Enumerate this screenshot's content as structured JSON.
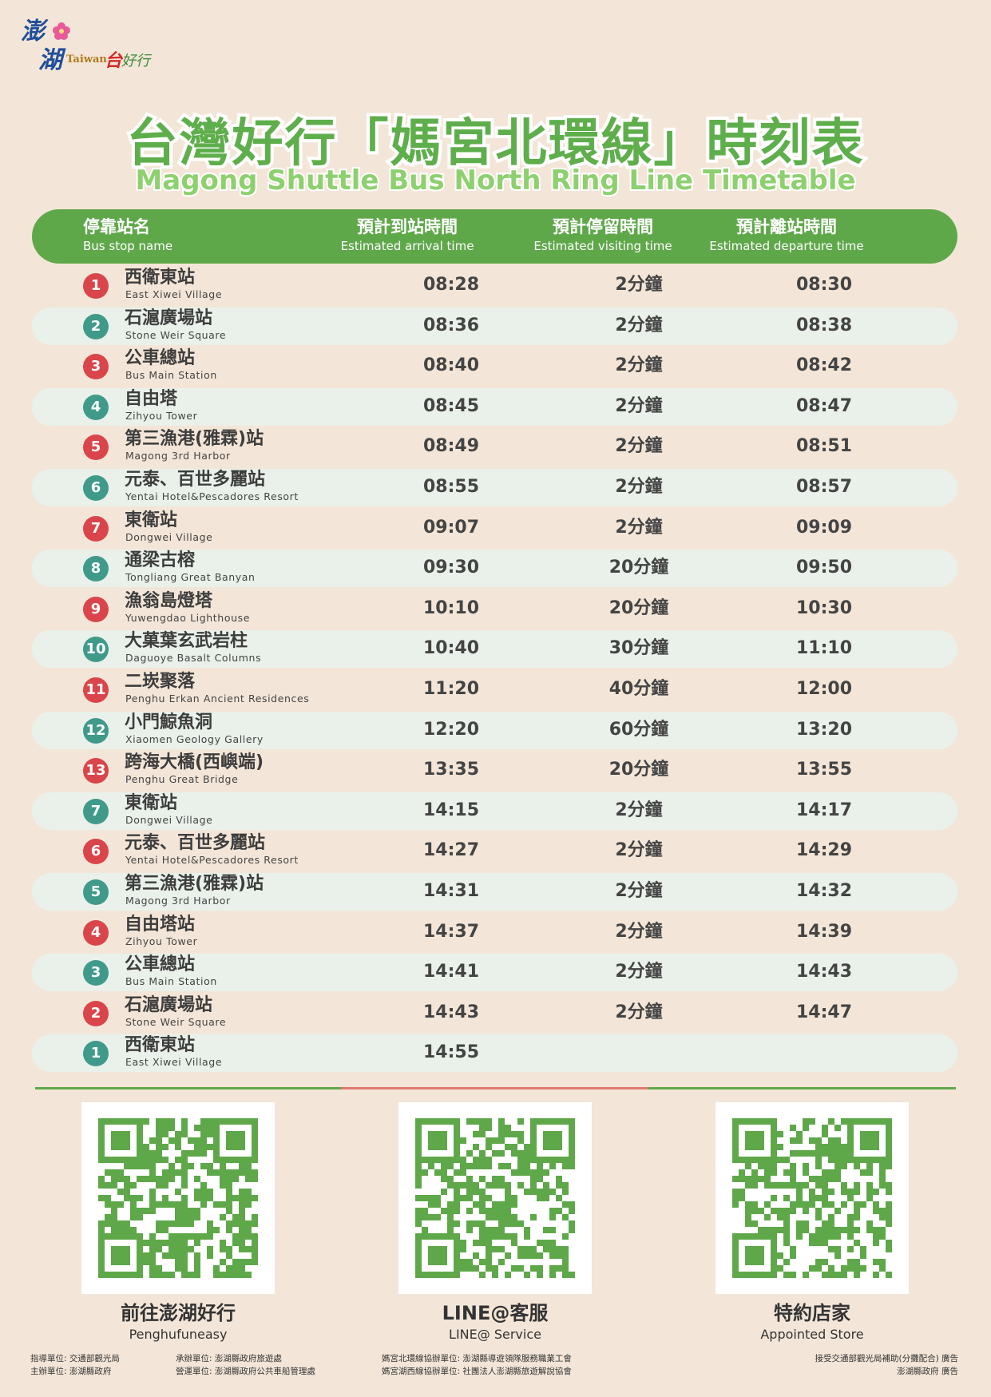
{
  "logo": {
    "p1": "澎",
    "p2": "湖",
    "taiwan": "Taiwan",
    "hx": "台",
    "hx2": "好行"
  },
  "title": {
    "zh": "台灣好行「媽宮北環線」時刻表",
    "en": "Magong Shuttle Bus North Ring Line Timetable"
  },
  "colors": {
    "green": "#5fa84a",
    "red": "#d9454a",
    "teal": "#3f9a8a",
    "band": "#e9f1ea",
    "background": "#f3e6d8"
  },
  "header": {
    "stop": {
      "zh": "停靠站名",
      "en": "Bus stop name"
    },
    "arrival": {
      "zh": "預計到站時間",
      "en": "Estimated arrival time"
    },
    "visit": {
      "zh": "預計停留時間",
      "en": "Estimated visiting time"
    },
    "depart": {
      "zh": "預計離站時間",
      "en": "Estimated departure time"
    }
  },
  "rows": [
    {
      "num": "1",
      "color": "red",
      "zh": "西衛東站",
      "en": "East Xiwei Village",
      "arrival": "08:28",
      "visit": "2分鐘",
      "depart": "08:30"
    },
    {
      "num": "2",
      "color": "teal",
      "zh": "石滬廣場站",
      "en": "Stone Weir Square",
      "arrival": "08:36",
      "visit": "2分鐘",
      "depart": "08:38"
    },
    {
      "num": "3",
      "color": "red",
      "zh": "公車總站",
      "en": "Bus Main Station",
      "arrival": "08:40",
      "visit": "2分鐘",
      "depart": "08:42"
    },
    {
      "num": "4",
      "color": "teal",
      "zh": "自由塔",
      "en": "Zihyou Tower",
      "arrival": "08:45",
      "visit": "2分鐘",
      "depart": "08:47"
    },
    {
      "num": "5",
      "color": "red",
      "zh": "第三漁港(雅霖)站",
      "en": "Magong 3rd Harbor",
      "arrival": "08:49",
      "visit": "2分鐘",
      "depart": "08:51"
    },
    {
      "num": "6",
      "color": "teal",
      "zh": "元泰、百世多麗站",
      "en": "Yentai Hotel&Pescadores Resort",
      "arrival": "08:55",
      "visit": "2分鐘",
      "depart": "08:57"
    },
    {
      "num": "7",
      "color": "red",
      "zh": "東衛站",
      "en": "Dongwei Village",
      "arrival": "09:07",
      "visit": "2分鐘",
      "depart": "09:09"
    },
    {
      "num": "8",
      "color": "teal",
      "zh": "通梁古榕",
      "en": "Tongliang Great Banyan",
      "arrival": "09:30",
      "visit": "20分鐘",
      "depart": "09:50"
    },
    {
      "num": "9",
      "color": "red",
      "zh": "漁翁島燈塔",
      "en": "Yuwengdao  Lighthouse",
      "arrival": "10:10",
      "visit": "20分鐘",
      "depart": "10:30"
    },
    {
      "num": "10",
      "color": "teal",
      "zh": "大菓葉玄武岩柱",
      "en": "Daguoye Basalt Columns",
      "arrival": "10:40",
      "visit": "30分鐘",
      "depart": "11:10"
    },
    {
      "num": "11",
      "color": "red",
      "zh": "二崁聚落",
      "en": "Penghu Erkan Ancient Residences",
      "arrival": "11:20",
      "visit": "40分鐘",
      "depart": "12:00"
    },
    {
      "num": "12",
      "color": "teal",
      "zh": "小門鯨魚洞",
      "en": "Xiaomen Geology Gallery",
      "arrival": "12:20",
      "visit": "60分鐘",
      "depart": "13:20"
    },
    {
      "num": "13",
      "color": "red",
      "zh": "跨海大橋(西嶼端)",
      "en": "Penghu Great Bridge",
      "arrival": "13:35",
      "visit": "20分鐘",
      "depart": "13:55"
    },
    {
      "num": "7",
      "color": "teal",
      "zh": "東衛站",
      "en": "Dongwei Village",
      "arrival": "14:15",
      "visit": "2分鐘",
      "depart": "14:17"
    },
    {
      "num": "6",
      "color": "red",
      "zh": "元泰、百世多麗站",
      "en": "Yentai Hotel&Pescadores Resort",
      "arrival": "14:27",
      "visit": "2分鐘",
      "depart": "14:29"
    },
    {
      "num": "5",
      "color": "teal",
      "zh": "第三漁港(雅霖)站",
      "en": "Magong 3rd Harbor",
      "arrival": "14:31",
      "visit": "2分鐘",
      "depart": "14:32"
    },
    {
      "num": "4",
      "color": "red",
      "zh": "自由塔站",
      "en": "Zihyou Tower",
      "arrival": "14:37",
      "visit": "2分鐘",
      "depart": "14:39"
    },
    {
      "num": "3",
      "color": "teal",
      "zh": "公車總站",
      "en": "Bus Main Station",
      "arrival": "14:41",
      "visit": "2分鐘",
      "depart": "14:43"
    },
    {
      "num": "2",
      "color": "red",
      "zh": "石滬廣場站",
      "en": "Stone Weir Square",
      "arrival": "14:43",
      "visit": "2分鐘",
      "depart": "14:47"
    },
    {
      "num": "1",
      "color": "teal",
      "zh": "西衛東站",
      "en": "East Xiwei Village",
      "arrival": "14:55",
      "visit": "",
      "depart": ""
    }
  ],
  "qr": [
    {
      "zh": "前往澎湖好行",
      "en": "Penghufuneasy",
      "icon": "qr-code-icon"
    },
    {
      "zh": "LINE@客服",
      "en": "LINE@ Service",
      "icon": "qr-code-icon"
    },
    {
      "zh": "特約店家",
      "en": "Appointed Store",
      "icon": "qr-code-icon"
    }
  ],
  "footer": {
    "col1a": "指導單位: 交通部觀光局",
    "col1b": "主辦單位: 澎湖縣政府",
    "col2a": "承辦單位: 澎湖縣政府旅遊處",
    "col2b": "營運單位: 澎湖縣政府公共車船管理處",
    "col3a": "媽宮北環線協辦單位: 澎湖縣導遊領隊服務職業工會",
    "col3b": "媽宮湖西線協辦單位: 社團法人澎湖縣旅遊解說協會",
    "col4a": "接受交通部觀光局補助(分攤配合) 廣告",
    "col4b": "澎湖縣政府 廣告"
  }
}
